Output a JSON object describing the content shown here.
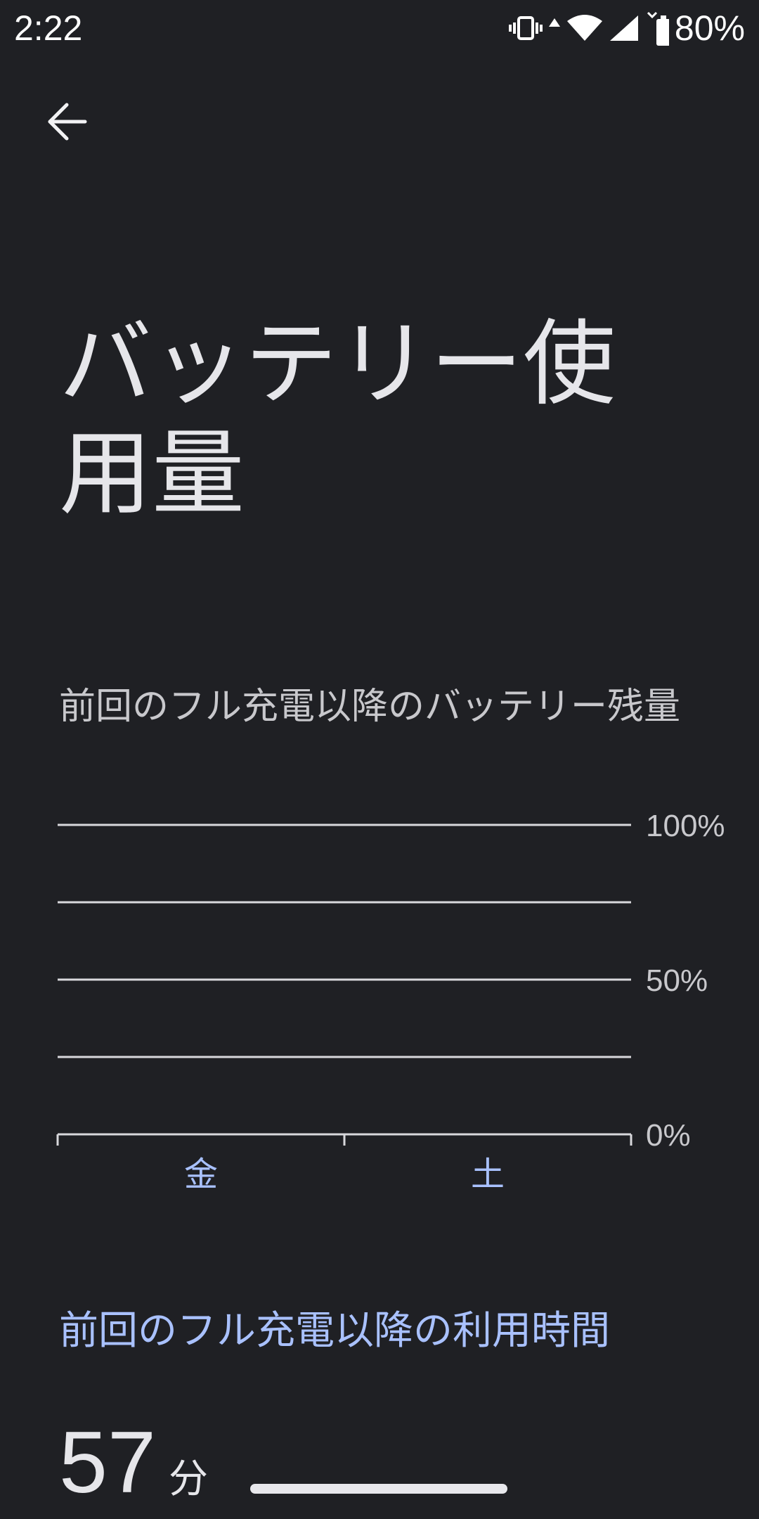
{
  "status_bar": {
    "time": "2:22",
    "battery_percent": "80%",
    "icons": [
      "vibrate-icon",
      "data-activity-icon",
      "wifi-icon",
      "cell-signal-icon",
      "battery-icon"
    ]
  },
  "header": {
    "back_icon": "arrow-back-icon",
    "title": "バッテリー使用量"
  },
  "chart_section": {
    "title": "前回のフル充電以降のバッテリー残量"
  },
  "chart_data": {
    "type": "line",
    "title": "前回のフル充電以降のバッテリー残量",
    "categories": [
      "金",
      "土"
    ],
    "y_tick_labels": [
      "100%",
      "50%",
      "0%"
    ],
    "y_ticks": [
      100,
      50,
      0
    ],
    "ylim": [
      0,
      100
    ],
    "grid": true,
    "gridlines": [
      100,
      75,
      50,
      25,
      0
    ],
    "series": [],
    "category_label_color": "#a9c1ff",
    "grid_color": "#d8d8dc"
  },
  "usage_section": {
    "heading": "前回のフル充電以降の利用時間",
    "value": "57",
    "unit": "分"
  },
  "colors": {
    "background": "#1f2024",
    "accent": "#a9c1ff",
    "text_primary": "#e6e6ea",
    "text_secondary": "#c8c8cc"
  }
}
